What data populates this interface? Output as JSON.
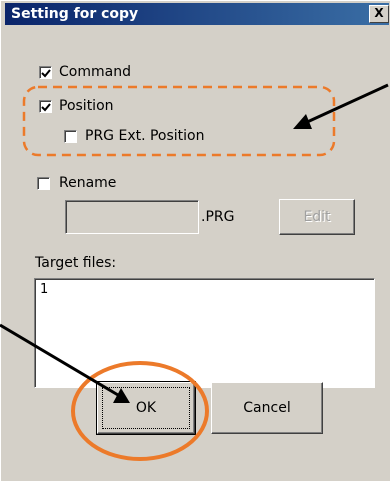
{
  "dialog": {
    "title": "Setting for copy",
    "close_glyph": "X"
  },
  "options": {
    "command": {
      "label": "Command",
      "checked": true
    },
    "position": {
      "label": "Position",
      "checked": true
    },
    "prg_ext_position": {
      "label": "PRG Ext. Position",
      "checked": false
    },
    "rename": {
      "label": "Rename",
      "checked": false
    }
  },
  "rename_field": {
    "value": "",
    "suffix": ".PRG"
  },
  "buttons": {
    "edit": "Edit",
    "ok": "OK",
    "cancel": "Cancel"
  },
  "target_files": {
    "label": "Target files:",
    "content": "1"
  },
  "annotations": {
    "highlight_color": "#ec7a2a",
    "arrow_color": "#000000"
  },
  "icons": [
    "checkmark-icon",
    "close-icon"
  ]
}
